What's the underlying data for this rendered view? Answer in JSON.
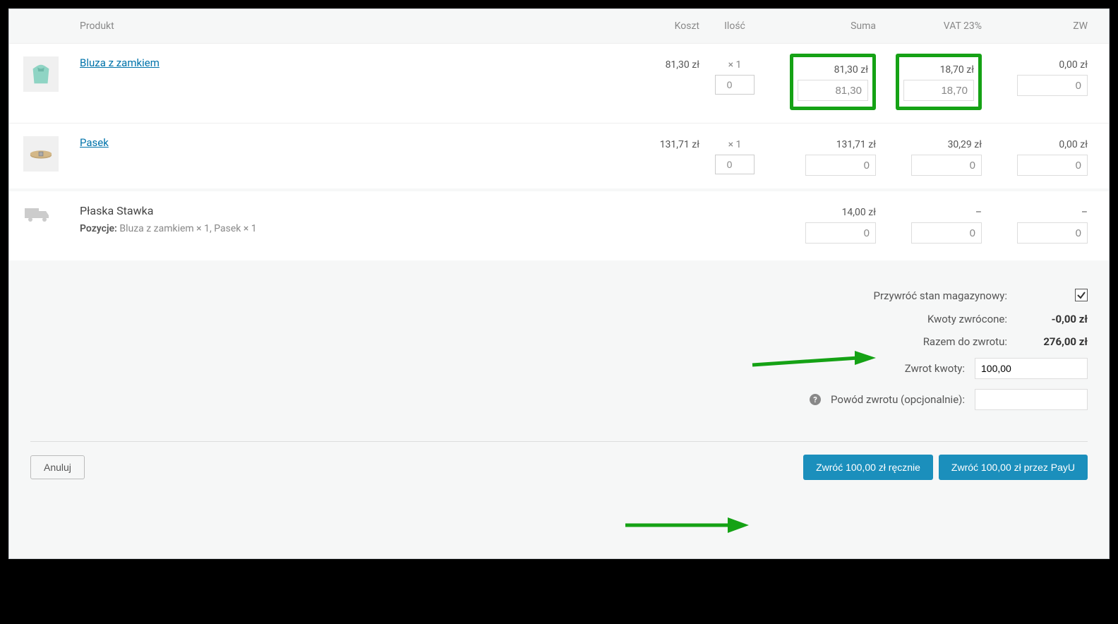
{
  "headers": {
    "product": "Produkt",
    "cost": "Koszt",
    "qty": "Ilość",
    "sum": "Suma",
    "vat": "VAT 23%",
    "zw": "ZW"
  },
  "items": [
    {
      "name": "Bluza z zamkiem",
      "cost": "81,30 zł",
      "qty_label": "× 1",
      "qty_input": "0",
      "sum": "81,30 zł",
      "sum_input": "81,30",
      "vat": "18,70 zł",
      "vat_input": "18,70",
      "zw": "0,00 zł",
      "zw_input": "0",
      "highlight": true
    },
    {
      "name": "Pasek",
      "cost": "131,71 zł",
      "qty_label": "× 1",
      "qty_input": "0",
      "sum": "131,71 zł",
      "sum_input": "0",
      "vat": "30,29 zł",
      "vat_input": "0",
      "zw": "0,00 zł",
      "zw_input": "0",
      "highlight": false
    }
  ],
  "shipping": {
    "name": "Płaska Stawka",
    "items_label": "Pozycje:",
    "items": "Bluza z zamkiem × 1, Pasek × 1",
    "sum": "14,00 zł",
    "sum_input": "0",
    "vat": "–",
    "vat_input": "0",
    "zw": "–",
    "zw_input": "0"
  },
  "totals": {
    "restock_label": "Przywróć stan magazynowy:",
    "refunded_label": "Kwoty zwrócone:",
    "refunded_value": "-0,00 zł",
    "total_refund_label": "Razem do zwrotu:",
    "total_refund_value": "276,00 zł",
    "refund_amount_label": "Zwrot kwoty:",
    "refund_amount_value": "100,00",
    "reason_label": "Powód zwrotu (opcjonalnie):",
    "reason_value": ""
  },
  "buttons": {
    "cancel": "Anuluj",
    "refund_manual": "Zwróć 100,00 zł ręcznie",
    "refund_payu": "Zwróć 100,00 zł przez PayU"
  }
}
